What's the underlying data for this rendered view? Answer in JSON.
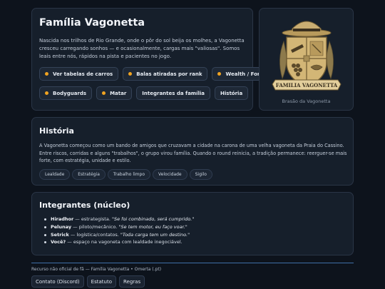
{
  "hero": {
    "title": "Família Vagonetta",
    "description": "Nascida nos trilhos de Rio Grande, onde o pôr do sol beija os molhes, a Vagonetta cresceu carregando sonhos — e ocasionalmente, cargas mais \"valiosas\". Somos leais entre nós, rápidos na pista e pacientes no jogo.",
    "actions": [
      {
        "label": "Ver tabelas de carros",
        "dot": true
      },
      {
        "label": "Balas atiradas por rank",
        "dot": true
      },
      {
        "label": "Wealth / Fortuna",
        "dot": true
      },
      {
        "label": "Bodyguards",
        "dot": true
      },
      {
        "label": "Matar",
        "dot": true
      },
      {
        "label": "Integrantes da família",
        "dot": false
      },
      {
        "label": "História",
        "dot": false
      }
    ]
  },
  "crest": {
    "banner_text": "FAMILIA VAGONETTA",
    "caption": "Brasão da Vagonetta"
  },
  "historia": {
    "title": "História",
    "text": "A Vagonetta começou como um bando de amigos que cruzavam a cidade na carona de uma velha vagoneta da Praia do Cassino. Entre riscos, corridas e alguns \"trabalhos\", o grupo virou família. Quando o round reinicia, a tradição permanece: reerguer-se mais forte, com estratégia, unidade e estilo.",
    "tags": [
      "Lealdade",
      "Estratégia",
      "Trabalho limpo",
      "Velocidade",
      "Sigilo"
    ]
  },
  "integrantes": {
    "title": "Integrantes (núcleo)",
    "members": [
      {
        "name": "Hiradhor",
        "role": " — estrategista. ",
        "quote": "\"Se foi combinado, será cumprido.\""
      },
      {
        "name": "Pelunay",
        "role": " — piloto/mecânico. ",
        "quote": "\"Se tem motor, eu faço voar.\""
      },
      {
        "name": "Setrick",
        "role": " — logística/contatos. ",
        "quote": "\"Toda carga tem um destino.\""
      },
      {
        "name": "Você?",
        "role": " — espaço na vagoneta com lealdade inegociável.",
        "quote": ""
      }
    ]
  },
  "footer": {
    "note": "Recurso não oficial de fã — Família Vagonetta • Omerta (.pt)",
    "links": [
      "Contato (Discord)",
      "Estatuto",
      "Regras"
    ]
  },
  "colors": {
    "background": "#0d131c",
    "card": "#161f2b",
    "accent_dot": "#f0a321",
    "footer_line": "#3f6fa8"
  }
}
